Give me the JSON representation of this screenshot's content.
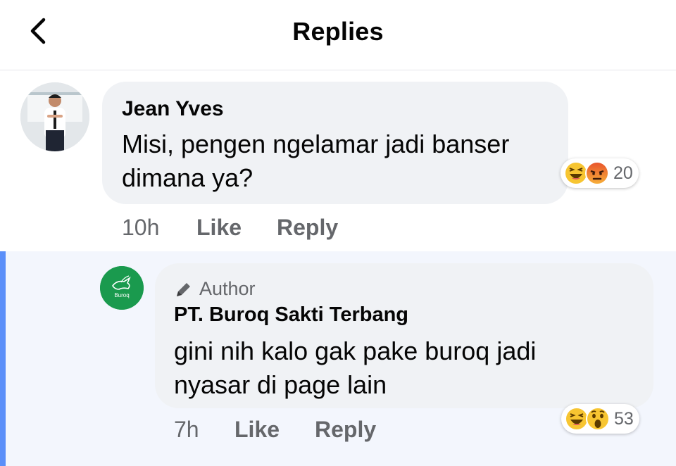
{
  "header": {
    "title": "Replies",
    "back_icon": "chevron-left-icon"
  },
  "comment": {
    "author": "Jean Yves",
    "text_line1": "Misi, pengen ngelamar jadi banser",
    "text_line2": "dimana ya?",
    "time": "10h",
    "like_label": "Like",
    "reply_label": "Reply",
    "reactions": [
      "haha-icon",
      "angry-icon"
    ],
    "reaction_count": "20"
  },
  "reply": {
    "badge": "Author",
    "badge_icon": "pencil-icon",
    "author": "PT. Buroq Sakti Terbang",
    "avatar_text": "Buroq",
    "text_line1": "gini nih kalo gak pake buroq jadi",
    "text_line2": "nyasar di page lain",
    "time": "7h",
    "like_label": "Like",
    "reply_label": "Reply",
    "reactions": [
      "haha-icon",
      "wow-icon"
    ],
    "reaction_count": "53"
  },
  "colors": {
    "accent_bar": "#5b8ff9",
    "bubble": "#f0f2f5",
    "reply_background": "#f3f6fd",
    "muted_text": "#65676b",
    "avatar_green": "#1a9a4e"
  }
}
